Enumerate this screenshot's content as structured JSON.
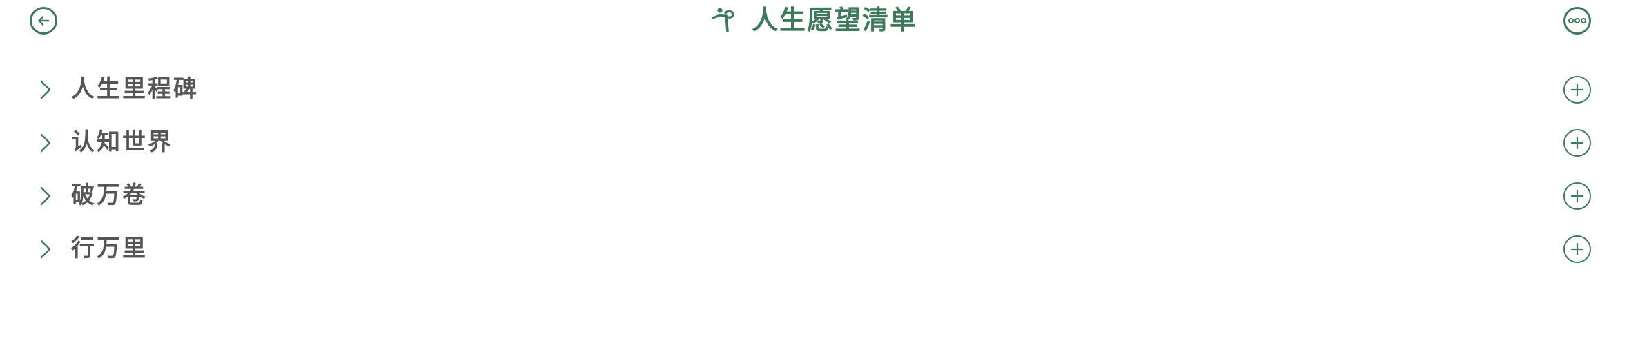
{
  "header": {
    "title": "人生愿望清单",
    "back_icon": "arrow-left-circle-icon",
    "more_icon": "more-horizontal-circle-icon",
    "title_icon": "person-walking-icon"
  },
  "categories": [
    {
      "label": "人生里程碑",
      "expand_icon": "chevron-right-icon",
      "add_icon": "plus-circle-icon"
    },
    {
      "label": "认知世界",
      "expand_icon": "chevron-right-icon",
      "add_icon": "plus-circle-icon"
    },
    {
      "label": "破万卷",
      "expand_icon": "chevron-right-icon",
      "add_icon": "plus-circle-icon"
    },
    {
      "label": "行万里",
      "expand_icon": "chevron-right-icon",
      "add_icon": "plus-circle-icon"
    }
  ],
  "colors": {
    "accent": "#3d7a5c",
    "label": "#555555",
    "background": "#ffffff"
  }
}
